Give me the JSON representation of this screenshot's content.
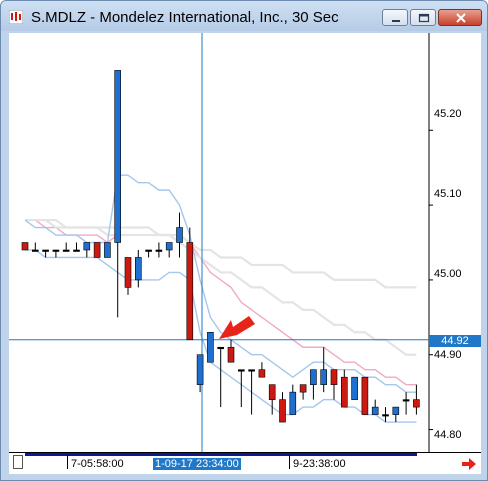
{
  "window": {
    "title": "S.MDLZ - Mondelez International, Inc., 30 Sec"
  },
  "price_axis": {
    "labels": [
      "45.20",
      "45.10",
      "45.00",
      "44.90",
      "44.80"
    ],
    "current_marker": "44.92"
  },
  "time_axis": {
    "labels": [
      "7-05:58:00",
      "9-23:38:00"
    ],
    "current_label": "1-09-17 23:34:00"
  },
  "colors": {
    "up": "#1f6fd0",
    "down": "#cc1a12",
    "crosshair": "#1f78c8",
    "ma_pink": "#f2a9c4",
    "ma_light": "#e4e4e4",
    "band": "#a6c6ec",
    "annotation_arrow": "#e8231a"
  },
  "icons": {
    "app": "chart-app-icon",
    "minimize": "minimize-icon",
    "maximize": "maximize-icon",
    "close": "close-icon",
    "nav": "scroll-right-arrow-icon"
  },
  "chart_data": {
    "type": "candlestick",
    "title": "S.MDLZ - Mondelez International, Inc., 30 Sec",
    "ylim": [
      44.77,
      45.33
    ],
    "crosshair_price": 44.92,
    "candles": [
      {
        "o": 45.05,
        "h": 45.05,
        "l": 45.04,
        "c": 45.04
      },
      {
        "o": 45.04,
        "h": 45.05,
        "l": 45.04,
        "c": 45.04
      },
      {
        "o": 45.04,
        "h": 45.04,
        "l": 45.03,
        "c": 45.04
      },
      {
        "o": 45.04,
        "h": 45.04,
        "l": 45.03,
        "c": 45.04
      },
      {
        "o": 45.04,
        "h": 45.05,
        "l": 45.04,
        "c": 45.04
      },
      {
        "o": 45.04,
        "h": 45.05,
        "l": 45.04,
        "c": 45.04
      },
      {
        "o": 45.04,
        "h": 45.05,
        "l": 45.03,
        "c": 45.05
      },
      {
        "o": 45.05,
        "h": 45.05,
        "l": 45.03,
        "c": 45.03
      },
      {
        "o": 45.03,
        "h": 45.05,
        "l": 45.03,
        "c": 45.05
      },
      {
        "o": 45.05,
        "h": 45.28,
        "l": 44.95,
        "c": 45.28
      },
      {
        "o": 45.03,
        "h": 45.03,
        "l": 44.98,
        "c": 44.99
      },
      {
        "o": 45.0,
        "h": 45.04,
        "l": 44.99,
        "c": 45.03
      },
      {
        "o": 45.04,
        "h": 45.04,
        "l": 45.03,
        "c": 45.04
      },
      {
        "o": 45.04,
        "h": 45.05,
        "l": 45.03,
        "c": 45.04
      },
      {
        "o": 45.04,
        "h": 45.05,
        "l": 45.03,
        "c": 45.05
      },
      {
        "o": 45.05,
        "h": 45.09,
        "l": 45.03,
        "c": 45.07
      },
      {
        "o": 45.05,
        "h": 45.07,
        "l": 44.92,
        "c": 44.92
      },
      {
        "o": 44.86,
        "h": 44.9,
        "l": 44.85,
        "c": 44.9
      },
      {
        "o": 44.89,
        "h": 44.93,
        "l": 44.89,
        "c": 44.93
      },
      {
        "o": 44.91,
        "h": 44.91,
        "l": 44.83,
        "c": 44.91
      },
      {
        "o": 44.91,
        "h": 44.92,
        "l": 44.9,
        "c": 44.89
      },
      {
        "o": 44.88,
        "h": 44.88,
        "l": 44.83,
        "c": 44.88
      },
      {
        "o": 44.88,
        "h": 44.88,
        "l": 44.82,
        "c": 44.88
      },
      {
        "o": 44.88,
        "h": 44.89,
        "l": 44.87,
        "c": 44.87
      },
      {
        "o": 44.86,
        "h": 44.86,
        "l": 44.82,
        "c": 44.84
      },
      {
        "o": 44.84,
        "h": 44.85,
        "l": 44.81,
        "c": 44.81
      },
      {
        "o": 44.82,
        "h": 44.86,
        "l": 44.82,
        "c": 44.85
      },
      {
        "o": 44.86,
        "h": 44.86,
        "l": 44.84,
        "c": 44.85
      },
      {
        "o": 44.86,
        "h": 44.88,
        "l": 44.84,
        "c": 44.88
      },
      {
        "o": 44.86,
        "h": 44.91,
        "l": 44.85,
        "c": 44.88
      },
      {
        "o": 44.88,
        "h": 44.88,
        "l": 44.84,
        "c": 44.86
      },
      {
        "o": 44.87,
        "h": 44.88,
        "l": 44.83,
        "c": 44.83
      },
      {
        "o": 44.84,
        "h": 44.87,
        "l": 44.84,
        "c": 44.87
      },
      {
        "o": 44.87,
        "h": 44.87,
        "l": 44.82,
        "c": 44.82
      },
      {
        "o": 44.82,
        "h": 44.84,
        "l": 44.82,
        "c": 44.83
      },
      {
        "o": 44.82,
        "h": 44.83,
        "l": 44.81,
        "c": 44.82
      },
      {
        "o": 44.82,
        "h": 44.83,
        "l": 44.81,
        "c": 44.83
      },
      {
        "o": 44.84,
        "h": 44.85,
        "l": 44.82,
        "c": 44.84
      },
      {
        "o": 44.84,
        "h": 44.86,
        "l": 44.82,
        "c": 44.83
      }
    ],
    "overlays": [
      {
        "color": "#f2a9c4",
        "values": [
          45.08,
          45.08,
          45.07,
          45.07,
          45.06,
          45.06,
          45.06,
          45.06,
          45.05,
          45.06,
          45.06,
          45.06,
          45.06,
          45.06,
          45.06,
          45.06,
          45.05,
          45.03,
          45.01,
          45.0,
          44.99,
          44.97,
          44.96,
          44.95,
          44.94,
          44.93,
          44.92,
          44.91,
          44.91,
          44.91,
          44.9,
          44.89,
          44.89,
          44.88,
          44.88,
          44.87,
          44.87,
          44.86,
          44.86
        ]
      },
      {
        "color": "#e4e4e4",
        "values": [
          45.08,
          45.08,
          45.08,
          45.07,
          45.07,
          45.07,
          45.07,
          45.07,
          45.06,
          45.06,
          45.06,
          45.06,
          45.06,
          45.06,
          45.06,
          45.05,
          45.04,
          45.03,
          45.02,
          45.01,
          45.01,
          45.0,
          44.99,
          44.99,
          44.98,
          44.97,
          44.97,
          44.96,
          44.96,
          44.95,
          44.94,
          44.94,
          44.93,
          44.93,
          44.92,
          44.92,
          44.91,
          44.9,
          44.9
        ]
      },
      {
        "color": "#e4e4e4",
        "values": [
          45.08,
          45.08,
          45.08,
          45.08,
          45.07,
          45.07,
          45.07,
          45.07,
          45.07,
          45.07,
          45.07,
          45.07,
          45.07,
          45.06,
          45.06,
          45.06,
          45.05,
          45.04,
          45.04,
          45.03,
          45.03,
          45.03,
          45.02,
          45.02,
          45.02,
          45.02,
          45.01,
          45.01,
          45.01,
          45.01,
          45.0,
          45.0,
          45.0,
          45.0,
          45.0,
          44.99,
          44.99,
          44.99,
          44.99
        ]
      },
      {
        "color": "#a6c6ec",
        "values": [
          45.08,
          45.07,
          45.07,
          45.06,
          45.06,
          45.06,
          45.05,
          45.05,
          45.05,
          45.14,
          45.14,
          45.13,
          45.13,
          45.12,
          45.12,
          45.1,
          45.06,
          45.0,
          44.95,
          44.93,
          44.92,
          44.91,
          44.9,
          44.9,
          44.89,
          44.88,
          44.87,
          44.88,
          44.89,
          44.89,
          44.88,
          44.88,
          44.88,
          44.87,
          44.87,
          44.86,
          44.86,
          44.85,
          44.85
        ]
      },
      {
        "color": "#a6c6ec",
        "values": [
          45.04,
          45.04,
          45.03,
          45.03,
          45.03,
          45.03,
          45.03,
          45.03,
          45.02,
          45.01,
          45.0,
          45.0,
          45.0,
          45.0,
          45.01,
          45.01,
          45.0,
          44.93,
          44.89,
          44.88,
          44.87,
          44.86,
          44.85,
          44.84,
          44.83,
          44.82,
          44.82,
          44.83,
          44.83,
          44.84,
          44.84,
          44.83,
          44.83,
          44.82,
          44.82,
          44.81,
          44.81,
          44.81,
          44.81
        ]
      }
    ]
  }
}
